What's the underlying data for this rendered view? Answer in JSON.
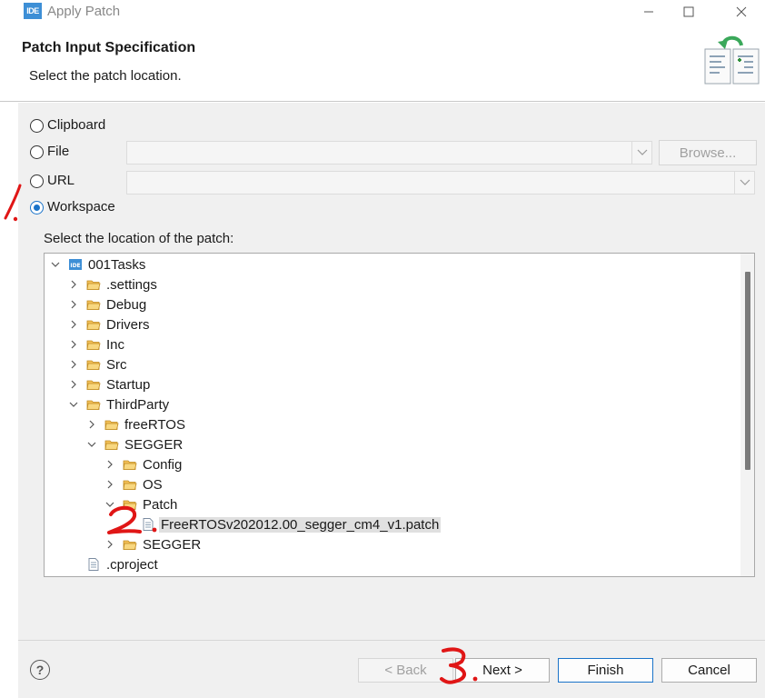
{
  "window": {
    "title": "Apply Patch",
    "app_icon_text": "IDE"
  },
  "header": {
    "title": "Patch Input Specification",
    "description": "Select the patch location."
  },
  "options": {
    "clipboard": "Clipboard",
    "file": "File",
    "url": "URL",
    "workspace": "Workspace",
    "selected": "Workspace"
  },
  "file": {
    "value": "",
    "browse_label": "Browse..."
  },
  "url": {
    "value": ""
  },
  "tree": {
    "label": "Select the location of the patch:",
    "items": [
      {
        "label": "001Tasks",
        "icon": "project-icon",
        "level": 0,
        "expanded": true
      },
      {
        "label": ".settings",
        "icon": "folder-icon",
        "level": 1,
        "expanded": false
      },
      {
        "label": "Debug",
        "icon": "folder-icon",
        "level": 1,
        "expanded": false
      },
      {
        "label": "Drivers",
        "icon": "folder-icon",
        "level": 1,
        "expanded": false
      },
      {
        "label": "Inc",
        "icon": "folder-icon",
        "level": 1,
        "expanded": false
      },
      {
        "label": "Src",
        "icon": "folder-icon",
        "level": 1,
        "expanded": false
      },
      {
        "label": "Startup",
        "icon": "folder-icon",
        "level": 1,
        "expanded": false
      },
      {
        "label": "ThirdParty",
        "icon": "folder-icon",
        "level": 1,
        "expanded": true
      },
      {
        "label": "freeRTOS",
        "icon": "folder-icon",
        "level": 2,
        "expanded": false
      },
      {
        "label": "SEGGER",
        "icon": "folder-icon",
        "level": 2,
        "expanded": true
      },
      {
        "label": "Config",
        "icon": "folder-icon",
        "level": 3,
        "expanded": false
      },
      {
        "label": "OS",
        "icon": "folder-icon",
        "level": 3,
        "expanded": false
      },
      {
        "label": "Patch",
        "icon": "folder-icon",
        "level": 3,
        "expanded": true
      },
      {
        "label": "FreeRTOSv202012.00_segger_cm4_v1.patch",
        "icon": "file-icon",
        "level": 4,
        "selected": true
      },
      {
        "label": "SEGGER",
        "icon": "folder-icon",
        "level": 3,
        "expanded": false
      },
      {
        "label": ".cproject",
        "icon": "file-icon",
        "level": 1
      }
    ]
  },
  "buttons": {
    "back": "< Back",
    "next": "Next >",
    "finish": "Finish",
    "cancel": "Cancel"
  },
  "annotations": {
    "one": "1.",
    "two": "2.",
    "three": "3."
  },
  "colors": {
    "accent": "#1a73c9",
    "annotation": "#e01616",
    "folder": "#e8b04a",
    "app_icon": "#3d8fd6"
  }
}
